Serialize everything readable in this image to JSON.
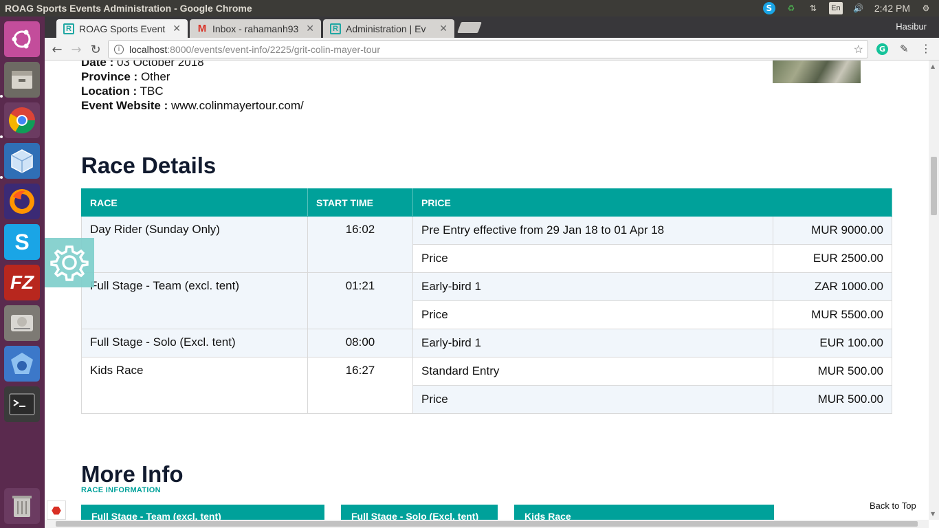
{
  "os": {
    "window_title": "ROAG Sports Events Administration - Google Chrome",
    "clock": "2:42 PM",
    "lang": "En"
  },
  "launcher": {
    "items": [
      "ubuntu-icon",
      "files-icon",
      "chrome-icon",
      "virtualbox-icon",
      "firefox-icon",
      "skype-icon",
      "filezilla-icon",
      "disk-icon",
      "app-icon",
      "terminal-icon",
      "trash-icon"
    ]
  },
  "browser": {
    "tabs": [
      {
        "label": "ROAG Sports Event",
        "favicon": "R",
        "active": true
      },
      {
        "label": "Inbox - rahamanh93",
        "favicon": "M",
        "active": false
      },
      {
        "label": "Administration | Ev",
        "favicon": "R",
        "active": false
      }
    ],
    "profile": "Hasibur",
    "url_host": "localhost",
    "url_path": ":8000/events/event-info/2225/grit-colin-mayer-tour"
  },
  "event_meta": {
    "date_label": "Date :",
    "date_value": "03 October 2018",
    "province_label": "Province :",
    "province_value": "Other",
    "location_label": "Location :",
    "location_value": "TBC",
    "website_label": "Event Website :",
    "website_value": "www.colinmayertour.com/"
  },
  "race_details": {
    "title": "Race Details",
    "headers": {
      "race": "RACE",
      "start_time": "START TIME",
      "price": "PRICE"
    },
    "rows": [
      {
        "race": "Day Rider (Sunday Only)",
        "start": "16:02",
        "prices": [
          {
            "label": "Pre Entry effective from 29 Jan 18 to 01 Apr 18",
            "amount": "MUR 9000.00"
          },
          {
            "label": "Price",
            "amount": "EUR 2500.00"
          }
        ]
      },
      {
        "race": "Full Stage - Team (excl. tent)",
        "start": "01:21",
        "prices": [
          {
            "label": "Early-bird 1",
            "amount": "ZAR 1000.00"
          },
          {
            "label": "Price",
            "amount": "MUR 5500.00"
          }
        ]
      },
      {
        "race": "Full Stage - Solo (Excl. tent)",
        "start": "08:00",
        "prices": [
          {
            "label": "Early-bird 1",
            "amount": "EUR 100.00"
          }
        ]
      },
      {
        "race": "Kids Race",
        "start": "16:27",
        "prices": [
          {
            "label": "Standard Entry",
            "amount": "MUR 500.00"
          },
          {
            "label": "Price",
            "amount": "MUR 500.00"
          }
        ]
      }
    ]
  },
  "more_info": {
    "title": "More Info",
    "subtitle": "RACE INFORMATION",
    "cards": [
      "Full Stage - Team (excl. tent)",
      "Full Stage - Solo (Excl. tent)",
      "Kids Race"
    ]
  },
  "back_to_top": "Back to Top",
  "colors": {
    "accent": "#00a19a",
    "launcher": "#5a2a4e",
    "panel": "#3c3b37"
  }
}
